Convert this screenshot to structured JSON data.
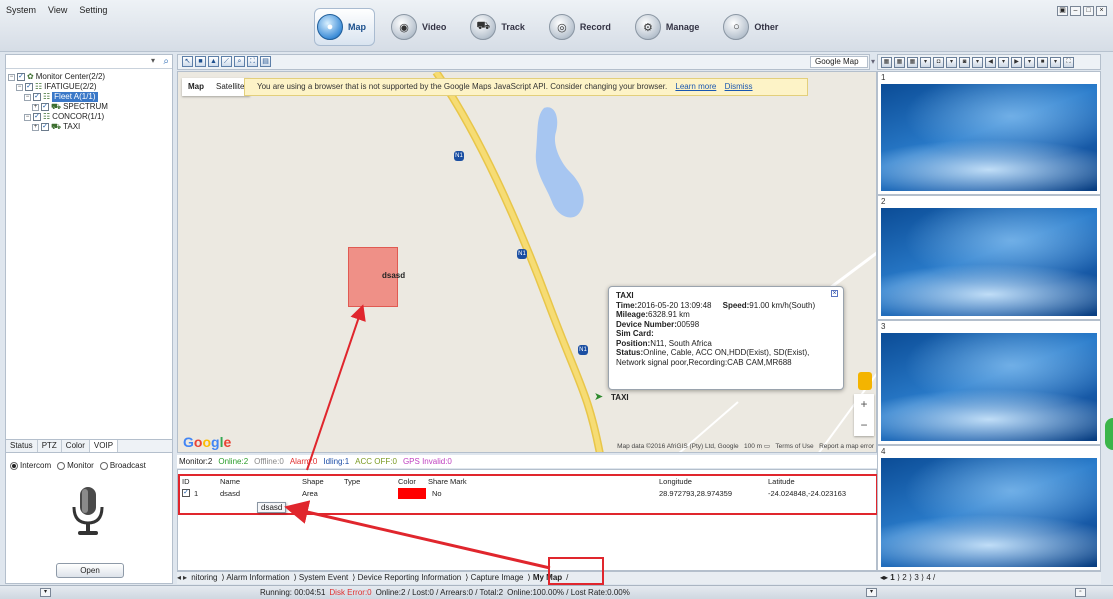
{
  "menu": [
    "System",
    "View",
    "Setting"
  ],
  "modules": [
    {
      "label": "Map",
      "icon": "globe-icon",
      "active": true
    },
    {
      "label": "Video",
      "icon": "video-icon",
      "active": false
    },
    {
      "label": "Track",
      "icon": "track-icon",
      "active": false
    },
    {
      "label": "Record",
      "icon": "record-icon",
      "active": false
    },
    {
      "label": "Manage",
      "icon": "manage-icon",
      "active": false
    },
    {
      "label": "Other",
      "icon": "other-icon",
      "active": false
    }
  ],
  "tree": [
    {
      "label": "Monitor Center(2/2)",
      "level": 0
    },
    {
      "label": "IFATIGUE(2/2)",
      "level": 1
    },
    {
      "label": "Fleet A(1/1)",
      "level": 2,
      "selected": true
    },
    {
      "label": "SPECTRUM",
      "level": 3
    },
    {
      "label": "CONCOR(1/1)",
      "level": 2
    },
    {
      "label": "TAXI",
      "level": 3
    }
  ],
  "control_tabs": [
    "Status",
    "PTZ",
    "Color",
    "VOIP"
  ],
  "voip": {
    "modes": [
      "Intercom",
      "Monitor",
      "Broadcast"
    ],
    "selected": "Intercom",
    "open_label": "Open"
  },
  "map_provider": "Google Map",
  "map": {
    "type_buttons": [
      "Map",
      "Satellite"
    ],
    "notice": "You are using a browser that is not supported by the Google Maps JavaScript API. Consider changing your browser.",
    "learn_more": "Learn more",
    "dismiss": "Dismiss",
    "area_label": "dsasd",
    "road_shield": "N1",
    "vehicle_label": "TAXI",
    "attribution": "Map data ©2016 AfriGIS (Pty) Ltd, Google",
    "scale": "100 m",
    "terms": "Terms of Use",
    "report": "Report a map error",
    "zoom_in": "+",
    "zoom_out": "−",
    "logo": [
      "G",
      "o",
      "o",
      "g",
      "l",
      "e"
    ]
  },
  "popup": {
    "title": "TAXI",
    "time_label": "Time:",
    "time": "2016-05-20 13:09:48",
    "speed_label": "Speed:",
    "speed": "91.00 km/h(South)",
    "mileage_label": "Mileage:",
    "mileage": "6328.91 km",
    "device_label": "Device Number:",
    "device": "00598",
    "sim_label": "Sim Card:",
    "sim": "",
    "position_label": "Position:",
    "position": "N11, South Africa",
    "status_label": "Status:",
    "status": "Online, Cable, ACC ON,HDD(Exist), SD(Exist), Network signal poor,Recording:CAB CAM,MR688"
  },
  "stats": [
    {
      "text": "Monitor:2",
      "color": "#222222"
    },
    {
      "text": "Online:2",
      "color": "#2a9d2a"
    },
    {
      "text": "Offline:0",
      "color": "#888888"
    },
    {
      "text": "Alarm:0",
      "color": "#e03030"
    },
    {
      "text": "Idling:1",
      "color": "#1f4fa8"
    },
    {
      "text": "ACC OFF:0",
      "color": "#7a9a22"
    },
    {
      "text": "GPS Invalid:0",
      "color": "#c040c0"
    }
  ],
  "table": {
    "headers": [
      "ID",
      "Name",
      "Shape",
      "Type",
      "Color",
      "Share",
      "Mark",
      "Longitude",
      "Latitude"
    ],
    "rows": [
      {
        "id": "1",
        "name": "dsasd",
        "shape": "Area",
        "type": "",
        "color": "#ff0000",
        "share": "No",
        "mark": "",
        "longitude": "28.972793,28.974359",
        "latitude": "-24.024848,-24.023163"
      }
    ],
    "tooltip": "dsasd"
  },
  "bottom_tabs": [
    "nitoring",
    "Alarm Information",
    "System Event",
    "Device Reporting Information",
    "Capture Image",
    "My Map"
  ],
  "active_bottom_tab": "My Map",
  "video_panes": [
    "1",
    "2",
    "3",
    "4"
  ],
  "video_pages": [
    "1",
    "2",
    "3",
    "4"
  ],
  "footer": [
    {
      "text": "Running: 00:04:51",
      "color": "#222222"
    },
    {
      "text": "Disk Error:0",
      "color": "#e03030"
    },
    {
      "text": "Online:2 / Lost:0 / Arrears:0 / Total:2",
      "color": "#222222"
    },
    {
      "text": "Online:100.00% / Lost Rate:0.00%",
      "color": "#222222"
    }
  ]
}
